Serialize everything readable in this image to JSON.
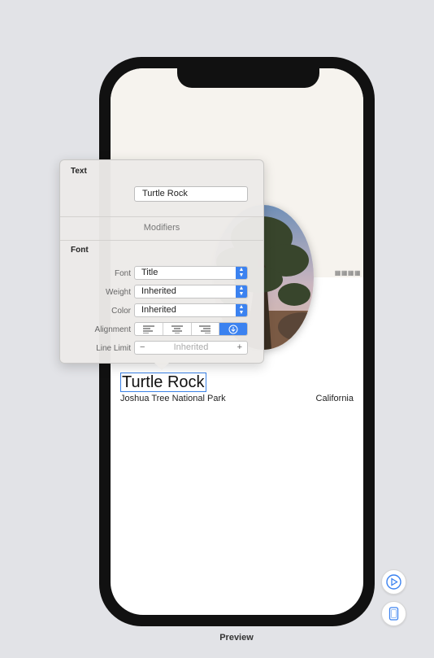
{
  "preview": {
    "title": "Turtle Rock",
    "park": "Joshua Tree National Park",
    "state": "California",
    "map_label": "▦▦▦▦",
    "footer_label": "Preview"
  },
  "inspector": {
    "text_section": "Text",
    "text_value": "Turtle Rock",
    "modifiers_label": "Modifiers",
    "font_section": "Font",
    "rows": {
      "font": {
        "label": "Font",
        "value": "Title"
      },
      "weight": {
        "label": "Weight",
        "value": "Inherited"
      },
      "color": {
        "label": "Color",
        "value": "Inherited"
      },
      "alignment": {
        "label": "Alignment"
      },
      "line_limit": {
        "label": "Line Limit",
        "value": "Inherited",
        "minus": "−",
        "plus": "+"
      }
    }
  },
  "colors": {
    "accent": "#3b82f0",
    "background": "#e2e3e7",
    "phone_frame": "#111111"
  },
  "icons": {
    "align_left": "align-left-icon",
    "align_center": "align-center-icon",
    "align_right": "align-right-icon",
    "align_natural": "download-circle-icon",
    "live_preview": "play-circle-icon",
    "device": "device-icon"
  }
}
